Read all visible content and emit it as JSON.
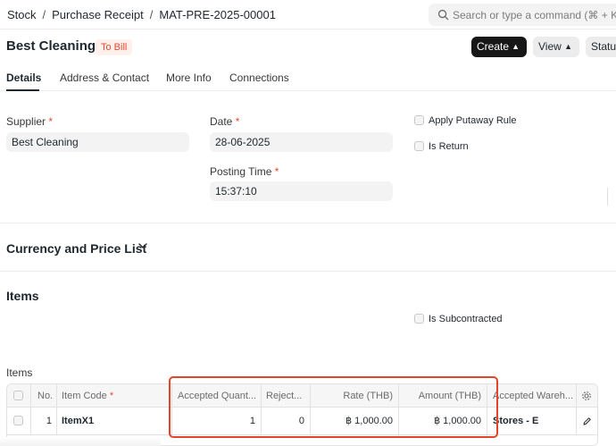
{
  "breadcrumb": {
    "items": [
      "Stock",
      "Purchase Receipt",
      "MAT-PRE-2025-00001"
    ],
    "separator": "/"
  },
  "search": {
    "placeholder": "Search or type a command (⌘ + K)"
  },
  "header": {
    "title": "Best Cleaning",
    "status_badge": "To Bill",
    "create_label": "Create",
    "view_label": "View",
    "status_label": "Status"
  },
  "tabs": [
    {
      "label": "Details",
      "active": true
    },
    {
      "label": "Address & Contact",
      "active": false
    },
    {
      "label": "More Info",
      "active": false
    },
    {
      "label": "Connections",
      "active": false
    }
  ],
  "form": {
    "supplier": {
      "label": "Supplier",
      "required": "*",
      "value": "Best Cleaning"
    },
    "date": {
      "label": "Date",
      "required": "*",
      "value": "28-06-2025"
    },
    "posting_time": {
      "label": "Posting Time",
      "required": "*",
      "value": "15:37:10"
    },
    "apply_putaway_rule": {
      "label": "Apply Putaway Rule",
      "checked": false
    },
    "is_return": {
      "label": "Is Return",
      "checked": false
    },
    "is_subcontracted": {
      "label": "Is Subcontracted",
      "checked": false
    }
  },
  "sections": {
    "currency": "Currency and Price List",
    "items": "Items"
  },
  "items_table": {
    "label": "Items",
    "columns": {
      "no": "No.",
      "item_code": "Item Code",
      "item_code_required": "*",
      "accepted_qty": "Accepted Quant...",
      "rejected_qty": "Reject...",
      "rate": "Rate (THB)",
      "amount": "Amount (THB)",
      "warehouse": "Accepted Wareh..."
    },
    "rows": [
      {
        "no": "1",
        "item_code": "ItemX1",
        "accepted_qty": "1",
        "rejected_qty": "0",
        "rate": "฿ 1,000.00",
        "amount": "฿ 1,000.00",
        "warehouse": "Stores - E"
      }
    ]
  },
  "colors": {
    "accent_dark": "#171717",
    "badge_text": "#e24c32",
    "highlight": "#e2452a"
  }
}
